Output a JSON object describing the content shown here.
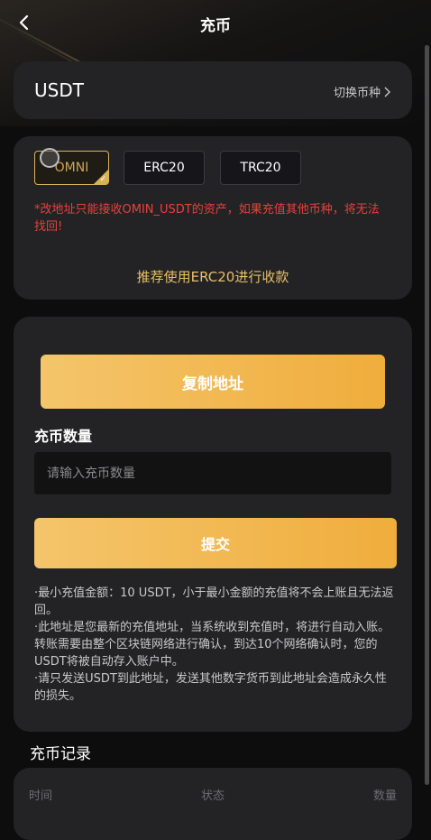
{
  "header": {
    "title": "充币"
  },
  "currency": {
    "name": "USDT",
    "switch_label": "切换币种"
  },
  "network": {
    "options": [
      "OMNI",
      "ERC20",
      "TRC20"
    ],
    "selected": "OMNI",
    "warning": "*改地址只能接收OMIN_USDT的资产，如果充值其他币种，将无法找回!",
    "recommend": "推荐使用ERC20进行收款"
  },
  "deposit": {
    "copy_button": "复制地址",
    "amount_label": "充币数量",
    "amount_placeholder": "请输入充币数量",
    "amount_value": "",
    "submit_button": "提交",
    "notes": [
      "·最小充值金额：10 USDT，小于最小金额的充值将不会上账且无法返回。",
      "·此地址是您最新的充值地址，当系统收到充值时，将进行自动入账。转账需要由整个区块链网络进行确认，到达10个网络确认时，您的USDT将被自动存入账户中。",
      "·请只发送USDT到此地址，发送其他数字货币到此地址会造成永久性的损失。"
    ]
  },
  "records": {
    "title": "充币记录",
    "columns": [
      "时间",
      "状态",
      "数量"
    ]
  },
  "colors": {
    "accent": "#f0ad3c",
    "warning": "#e8403c",
    "recommend": "#e9bf6a",
    "card": "#232325"
  }
}
